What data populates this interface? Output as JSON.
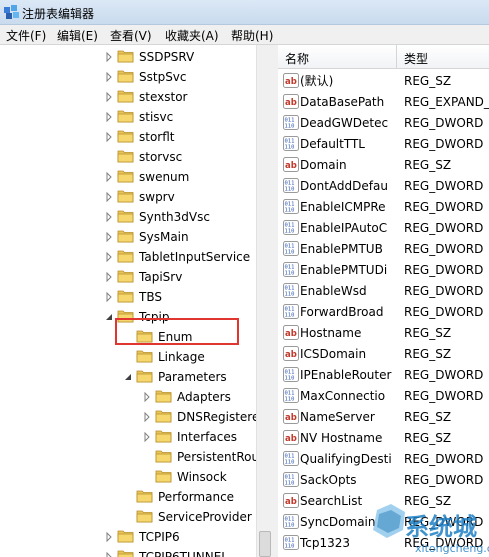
{
  "window": {
    "title": "注册表编辑器",
    "icon": "registry-editor-icon"
  },
  "menu": [
    {
      "label": "文件(F)"
    },
    {
      "label": "编辑(E)"
    },
    {
      "label": "查看(V)"
    },
    {
      "label": "收藏夹(A)"
    },
    {
      "label": "帮助(H)"
    }
  ],
  "tree": {
    "items": [
      {
        "label": "SSDPSRV",
        "expander": "collapsed"
      },
      {
        "label": "SstpSvc",
        "expander": "collapsed"
      },
      {
        "label": "stexstor",
        "expander": "collapsed"
      },
      {
        "label": "stisvc",
        "expander": "collapsed"
      },
      {
        "label": "storflt",
        "expander": "collapsed"
      },
      {
        "label": "storvsc",
        "expander": "none"
      },
      {
        "label": "swenum",
        "expander": "collapsed"
      },
      {
        "label": "swprv",
        "expander": "collapsed"
      },
      {
        "label": "Synth3dVsc",
        "expander": "collapsed"
      },
      {
        "label": "SysMain",
        "expander": "collapsed"
      },
      {
        "label": "TabletInputService",
        "expander": "collapsed"
      },
      {
        "label": "TapiSrv",
        "expander": "collapsed"
      },
      {
        "label": "TBS",
        "expander": "collapsed"
      },
      {
        "label": "Tcpip",
        "expander": "expanded"
      },
      {
        "label": "Enum",
        "expander": "none"
      },
      {
        "label": "Linkage",
        "expander": "none"
      },
      {
        "label": "Parameters",
        "expander": "expanded",
        "selected": true
      },
      {
        "label": "Adapters",
        "expander": "collapsed"
      },
      {
        "label": "DNSRegistere",
        "expander": "collapsed"
      },
      {
        "label": "Interfaces",
        "expander": "collapsed"
      },
      {
        "label": "PersistentRou",
        "expander": "none"
      },
      {
        "label": "Winsock",
        "expander": "none"
      },
      {
        "label": "Performance",
        "expander": "none"
      },
      {
        "label": "ServiceProvider",
        "expander": "none"
      },
      {
        "label": "TCPIP6",
        "expander": "collapsed"
      },
      {
        "label": "TCPIP6TUNNEL",
        "expander": "collapsed"
      }
    ]
  },
  "list": {
    "columns": {
      "name": "名称",
      "type": "类型"
    },
    "rows": [
      {
        "name": "(默认)",
        "type": "REG_SZ",
        "icon": "string-value-icon"
      },
      {
        "name": "DataBasePath",
        "type": "REG_EXPAND_",
        "icon": "string-value-icon"
      },
      {
        "name": "DeadGWDetec",
        "type": "REG_DWORD",
        "icon": "binary-value-icon"
      },
      {
        "name": "DefaultTTL",
        "type": "REG_DWORD",
        "icon": "binary-value-icon"
      },
      {
        "name": "Domain",
        "type": "REG_SZ",
        "icon": "string-value-icon"
      },
      {
        "name": "DontAddDefau",
        "type": "REG_DWORD",
        "icon": "binary-value-icon"
      },
      {
        "name": "EnableICMPRe",
        "type": "REG_DWORD",
        "icon": "binary-value-icon"
      },
      {
        "name": "EnableIPAutoC",
        "type": "REG_DWORD",
        "icon": "binary-value-icon"
      },
      {
        "name": "EnablePMTUB",
        "type": "REG_DWORD",
        "icon": "binary-value-icon"
      },
      {
        "name": "EnablePMTUDi",
        "type": "REG_DWORD",
        "icon": "binary-value-icon"
      },
      {
        "name": "EnableWsd",
        "type": "REG_DWORD",
        "icon": "binary-value-icon"
      },
      {
        "name": "ForwardBroad",
        "type": "REG_DWORD",
        "icon": "binary-value-icon"
      },
      {
        "name": "Hostname",
        "type": "REG_SZ",
        "icon": "string-value-icon"
      },
      {
        "name": "ICSDomain",
        "type": "REG_SZ",
        "icon": "string-value-icon"
      },
      {
        "name": "IPEnableRouter",
        "type": "REG_DWORD",
        "icon": "binary-value-icon"
      },
      {
        "name": "MaxConnectio",
        "type": "REG_DWORD",
        "icon": "binary-value-icon"
      },
      {
        "name": "NameServer",
        "type": "REG_SZ",
        "icon": "string-value-icon"
      },
      {
        "name": "NV Hostname",
        "type": "REG_SZ",
        "icon": "string-value-icon"
      },
      {
        "name": "QualifyingDesti",
        "type": "REG_DWORD",
        "icon": "binary-value-icon"
      },
      {
        "name": "SackOpts",
        "type": "REG_DWORD",
        "icon": "binary-value-icon"
      },
      {
        "name": "SearchList",
        "type": "REG_SZ",
        "icon": "string-value-icon"
      },
      {
        "name": "SyncDomain",
        "type": "REG_DWORD",
        "icon": "binary-value-icon"
      },
      {
        "name": "Tcp1323",
        "type": "REG_DWORD",
        "icon": "binary-value-icon"
      }
    ]
  },
  "watermark": {
    "text": "系统城",
    "subtext": "xitongcheng.com"
  },
  "colors": {
    "selection_highlight": "#e0362f",
    "folder": "#e8c35a",
    "string_icon": "#c0392b",
    "binary_icon": "#2b56b3"
  }
}
